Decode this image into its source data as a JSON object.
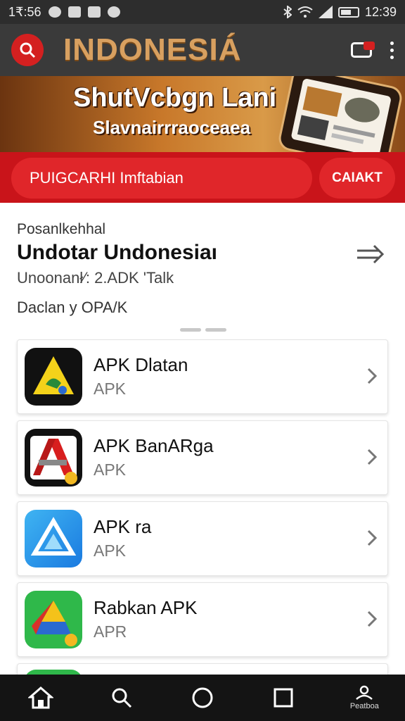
{
  "status_bar": {
    "time_left": "1₹:56",
    "time_right": "12:39"
  },
  "app_bar": {
    "title": "INDONESIÁ",
    "icons": [
      "search-icon",
      "cast-icon",
      "more-icon"
    ],
    "colors": {
      "search_bg": "#d42020",
      "title": "#d8a060"
    }
  },
  "banner": {
    "title": "ShutVcbgn Lani",
    "subtitle": "Slavnairrraoceaea"
  },
  "red_bar": {
    "main_label": "PUIGCARHI Imftabian",
    "side_label": "CAIAKT",
    "color": "#c9141a"
  },
  "info": {
    "small_label": "Posanlkehhal",
    "title": "Undotar Undonesiaı",
    "line1": "Unoonanł⁄: 2.ADK 'Talk",
    "line2": "Daclan y OPA/K"
  },
  "apps": [
    {
      "name": "APK Dlatan",
      "sub": "APK",
      "icon": "yellow-triangle-icon"
    },
    {
      "name": "APK BanARga",
      "sub": "APK",
      "icon": "red-a-icon"
    },
    {
      "name": "APK ra",
      "sub": "APK",
      "icon": "blue-triangle-icon"
    },
    {
      "name": "Rabkan APK",
      "sub": "APR",
      "icon": "green-drive-icon"
    }
  ],
  "bottom_nav": {
    "items": [
      "home-icon",
      "search-icon",
      "circle-icon",
      "square-icon",
      "profile-icon"
    ],
    "profile_label": "Peatboa"
  }
}
